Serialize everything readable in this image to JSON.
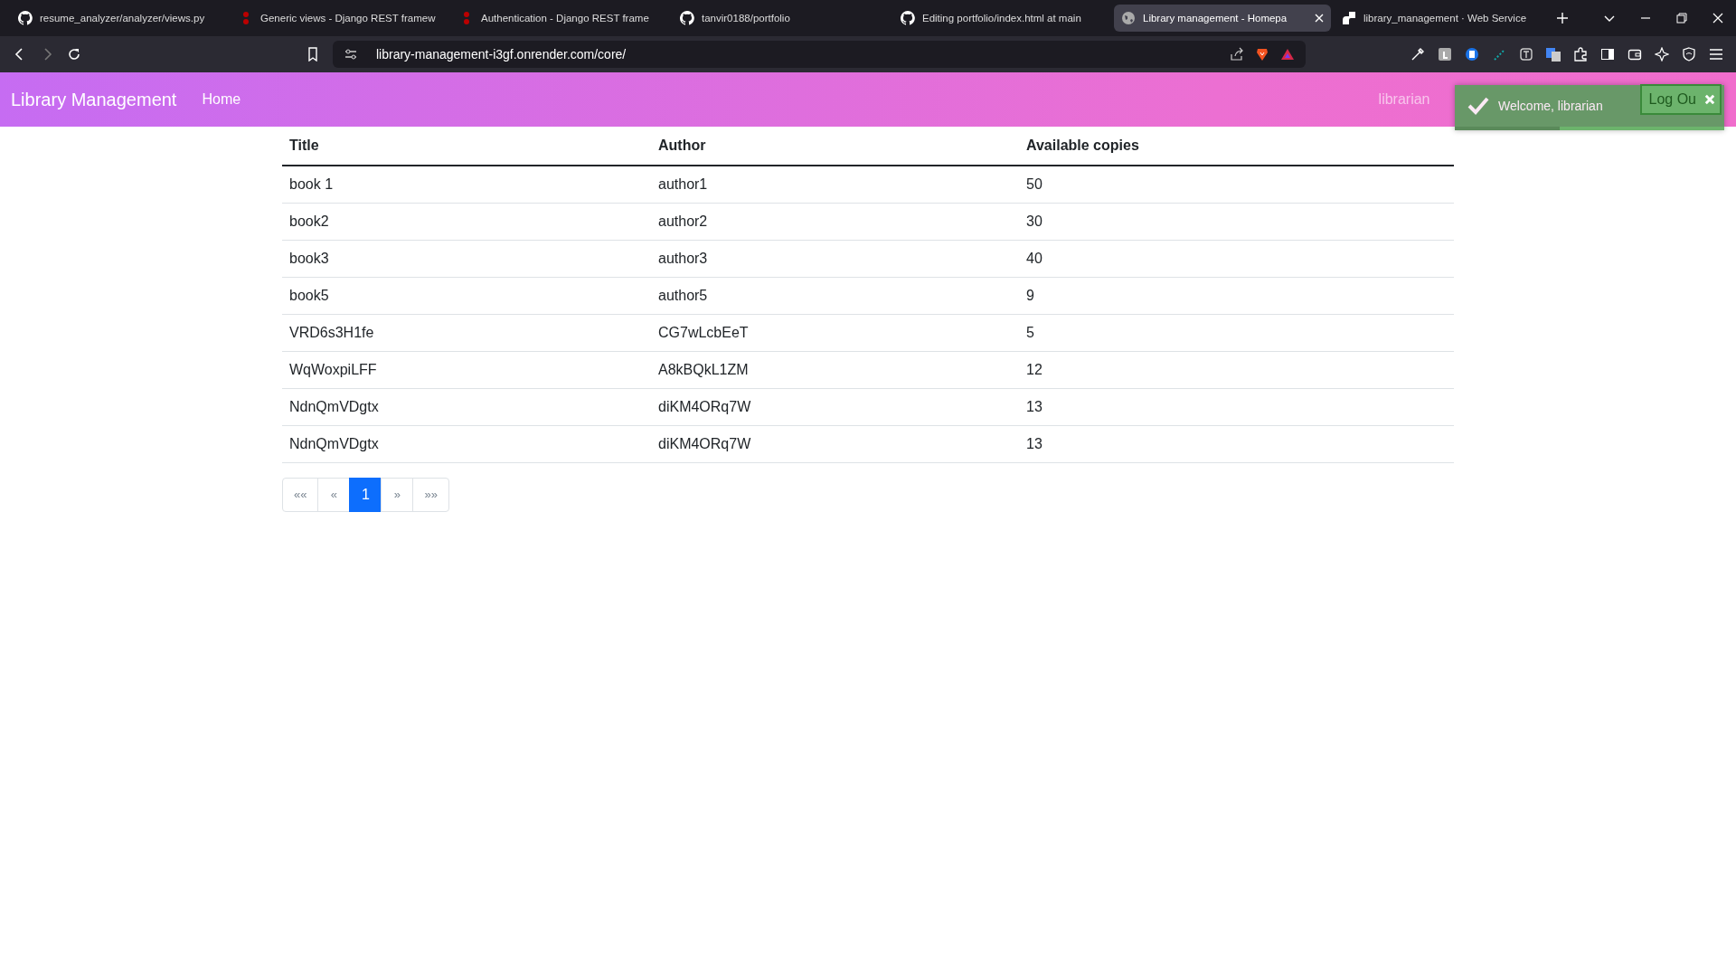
{
  "browser": {
    "tabs": [
      {
        "title": "resume_analyzer/analyzer/views.py",
        "kind": "github",
        "selected": false
      },
      {
        "title": "Generic views - Django REST framew",
        "kind": "django",
        "selected": false
      },
      {
        "title": "Authentication - Django REST frame",
        "kind": "django",
        "selected": false
      },
      {
        "title": "tanvir0188/portfolio",
        "kind": "github",
        "selected": false
      },
      {
        "title": "Editing portfolio/index.html at main",
        "kind": "github",
        "selected": false
      },
      {
        "title": "Library management - Homepa",
        "kind": "globe",
        "selected": true
      },
      {
        "title": "library_management · Web Service",
        "kind": "render",
        "selected": false
      }
    ],
    "address": "library-management-i3gf.onrender.com/core/"
  },
  "navbar": {
    "brand": "Library Management",
    "links": [
      "Home"
    ],
    "right_links": [
      "librarian"
    ],
    "logout": "Log Ou"
  },
  "toast": {
    "message": "Welcome, librarian",
    "level": 0.39
  },
  "table": {
    "columns": [
      "Title",
      "Author",
      "Available copies"
    ],
    "rows": [
      [
        "book 1",
        "author1",
        "50"
      ],
      [
        "book2",
        "author2",
        "30"
      ],
      [
        "book3",
        "author3",
        "40"
      ],
      [
        "book5",
        "author5",
        "9"
      ],
      [
        "VRD6s3H1fe",
        "CG7wLcbEeT",
        "5"
      ],
      [
        "WqWoxpiLFF",
        "A8kBQkL1ZM",
        "12"
      ],
      [
        "NdnQmVDgtx",
        "diKM4ORq7W",
        "13"
      ],
      [
        "NdnQmVDgtx",
        "diKM4ORq7W",
        "13"
      ]
    ]
  },
  "pagination": [
    {
      "label": "««",
      "selected": false
    },
    {
      "label": "«",
      "selected": false
    },
    {
      "label": "1",
      "selected": true
    },
    {
      "label": "»",
      "selected": false
    },
    {
      "label": "»»",
      "selected": false
    }
  ]
}
